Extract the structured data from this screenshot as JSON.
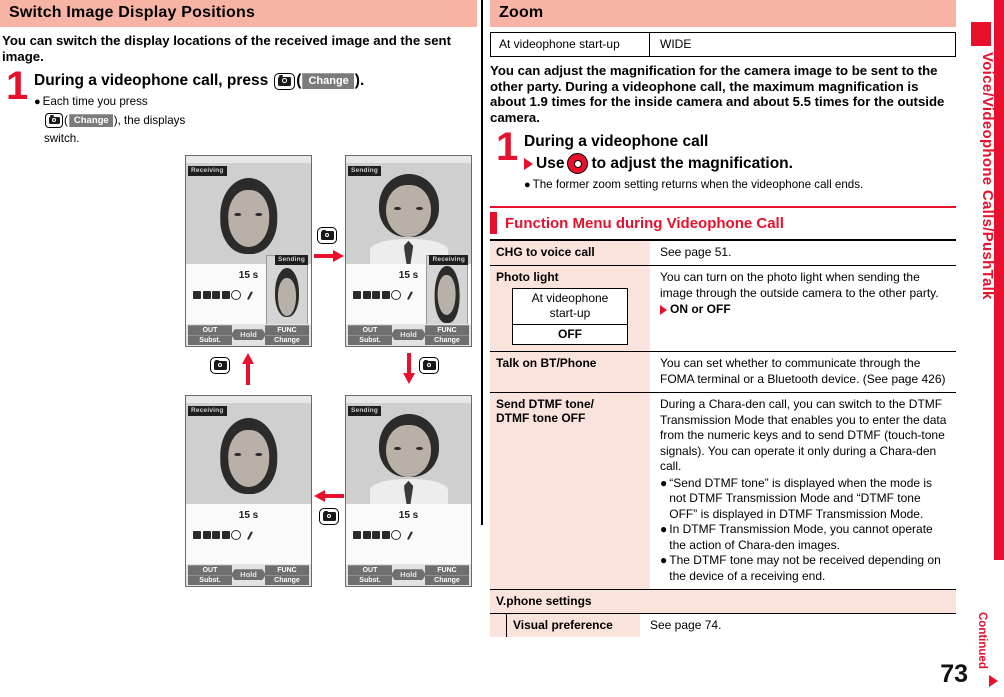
{
  "page": {
    "number": "73",
    "continued_label": "Continued",
    "side_tab_label": "Voice/Videophone Calls/PushTalk",
    "accent_red": "#e8112d",
    "heading_bg": "#f7b3a4",
    "table_key_bg": "#fbe3dd"
  },
  "left": {
    "section_title": "Switch Image Display Positions",
    "intro": "You can switch the display locations of the received image and the sent image.",
    "step": {
      "number": "1",
      "title_before_key": "During a videophone call, press",
      "key_icon": "camera-key-icon",
      "paren_open": "(",
      "softkey_label": "Change",
      "paren_close": ").",
      "bullet_dot": "●",
      "bullet_line1": "Each time you press",
      "bullet_line2_after_key": "), the displays",
      "bullet_line3": "switch."
    },
    "diagram": {
      "phones": [
        {
          "id": "phone-top-left",
          "main_label": "Receiving",
          "sub_label": "Sending",
          "timer": "15 s",
          "softkey_left_top": "OUT",
          "softkey_left_bottom": "Subst.",
          "softkey_center": "Hold",
          "softkey_right_top": "FUNC",
          "softkey_right_bottom": "Change"
        },
        {
          "id": "phone-top-right",
          "main_label": "Sending",
          "sub_label": "Receiving",
          "timer": "15 s",
          "softkey_left_top": "OUT",
          "softkey_left_bottom": "Subst.",
          "softkey_center": "Hold",
          "softkey_right_top": "FUNC",
          "softkey_right_bottom": "Change"
        },
        {
          "id": "phone-bottom-left",
          "main_label": "Receiving",
          "sub_label": "",
          "timer": "15 s",
          "softkey_left_top": "OUT",
          "softkey_left_bottom": "Subst.",
          "softkey_center": "Hold",
          "softkey_right_top": "FUNC",
          "softkey_right_bottom": "Change"
        },
        {
          "id": "phone-bottom-right",
          "main_label": "Sending",
          "sub_label": "",
          "timer": "15 s",
          "softkey_left_top": "OUT",
          "softkey_left_bottom": "Subst.",
          "softkey_center": "Hold",
          "softkey_right_top": "FUNC",
          "softkey_right_bottom": "Change"
        }
      ]
    }
  },
  "right": {
    "zoom_section": {
      "title": "Zoom",
      "setting_table": {
        "key": "At videophone start-up",
        "value": "WIDE"
      },
      "intro": "You can adjust the magnification for the camera image to be sent to the other party. During a videophone call, the maximum magnification is about 1.9 times for the inside camera and about 5.5 times for the outside camera.",
      "step": {
        "number": "1",
        "line1": "During a videophone call",
        "line2_before_key": "Use",
        "line2_after_key": "to adjust the magnification.",
        "key_icon": "navigation-stick-icon",
        "bullet_dot": "●",
        "bullet": "The former zoom setting returns when the videophone call ends."
      }
    },
    "function_menu": {
      "title": "Function Menu during Videophone Call",
      "rows": [
        {
          "key": "CHG to voice call",
          "value": "See page 51."
        },
        {
          "key": "Photo light",
          "value": "You can turn on the photo light when sending the image through the outside camera to the other party.",
          "option_line": "ON or OFF",
          "nested_box": {
            "label_line1": "At videophone",
            "label_line2": "start-up",
            "value": "OFF"
          }
        },
        {
          "key": "Talk on BT/Phone",
          "value": "You can set whether to communicate through the FOMA terminal or a Bluetooth device. (See page 426)"
        },
        {
          "key": "Send DTMF tone/ DTMF tone OFF",
          "key_line1": "Send DTMF tone/",
          "key_line2": "DTMF tone OFF",
          "value": "During a Chara-den call, you can switch to the DTMF Transmission Mode that enables you to enter the data from the numeric keys and to send DTMF (touch-tone signals). You can operate it only during a Chara-den call.",
          "bullets": [
            "“Send DTMF tone” is displayed when the mode is not DTMF Transmission Mode and “DTMF tone OFF” is displayed in DTMF Transmission Mode.",
            "In DTMF Transmission Mode, you cannot operate the action of Chara-den images.",
            "The DTMF tone may not be received depending on the device of a receiving end."
          ]
        }
      ],
      "vphone_settings": {
        "group_label": "V.phone settings",
        "sub_key": "Visual preference",
        "sub_value": "See page 74."
      }
    }
  }
}
